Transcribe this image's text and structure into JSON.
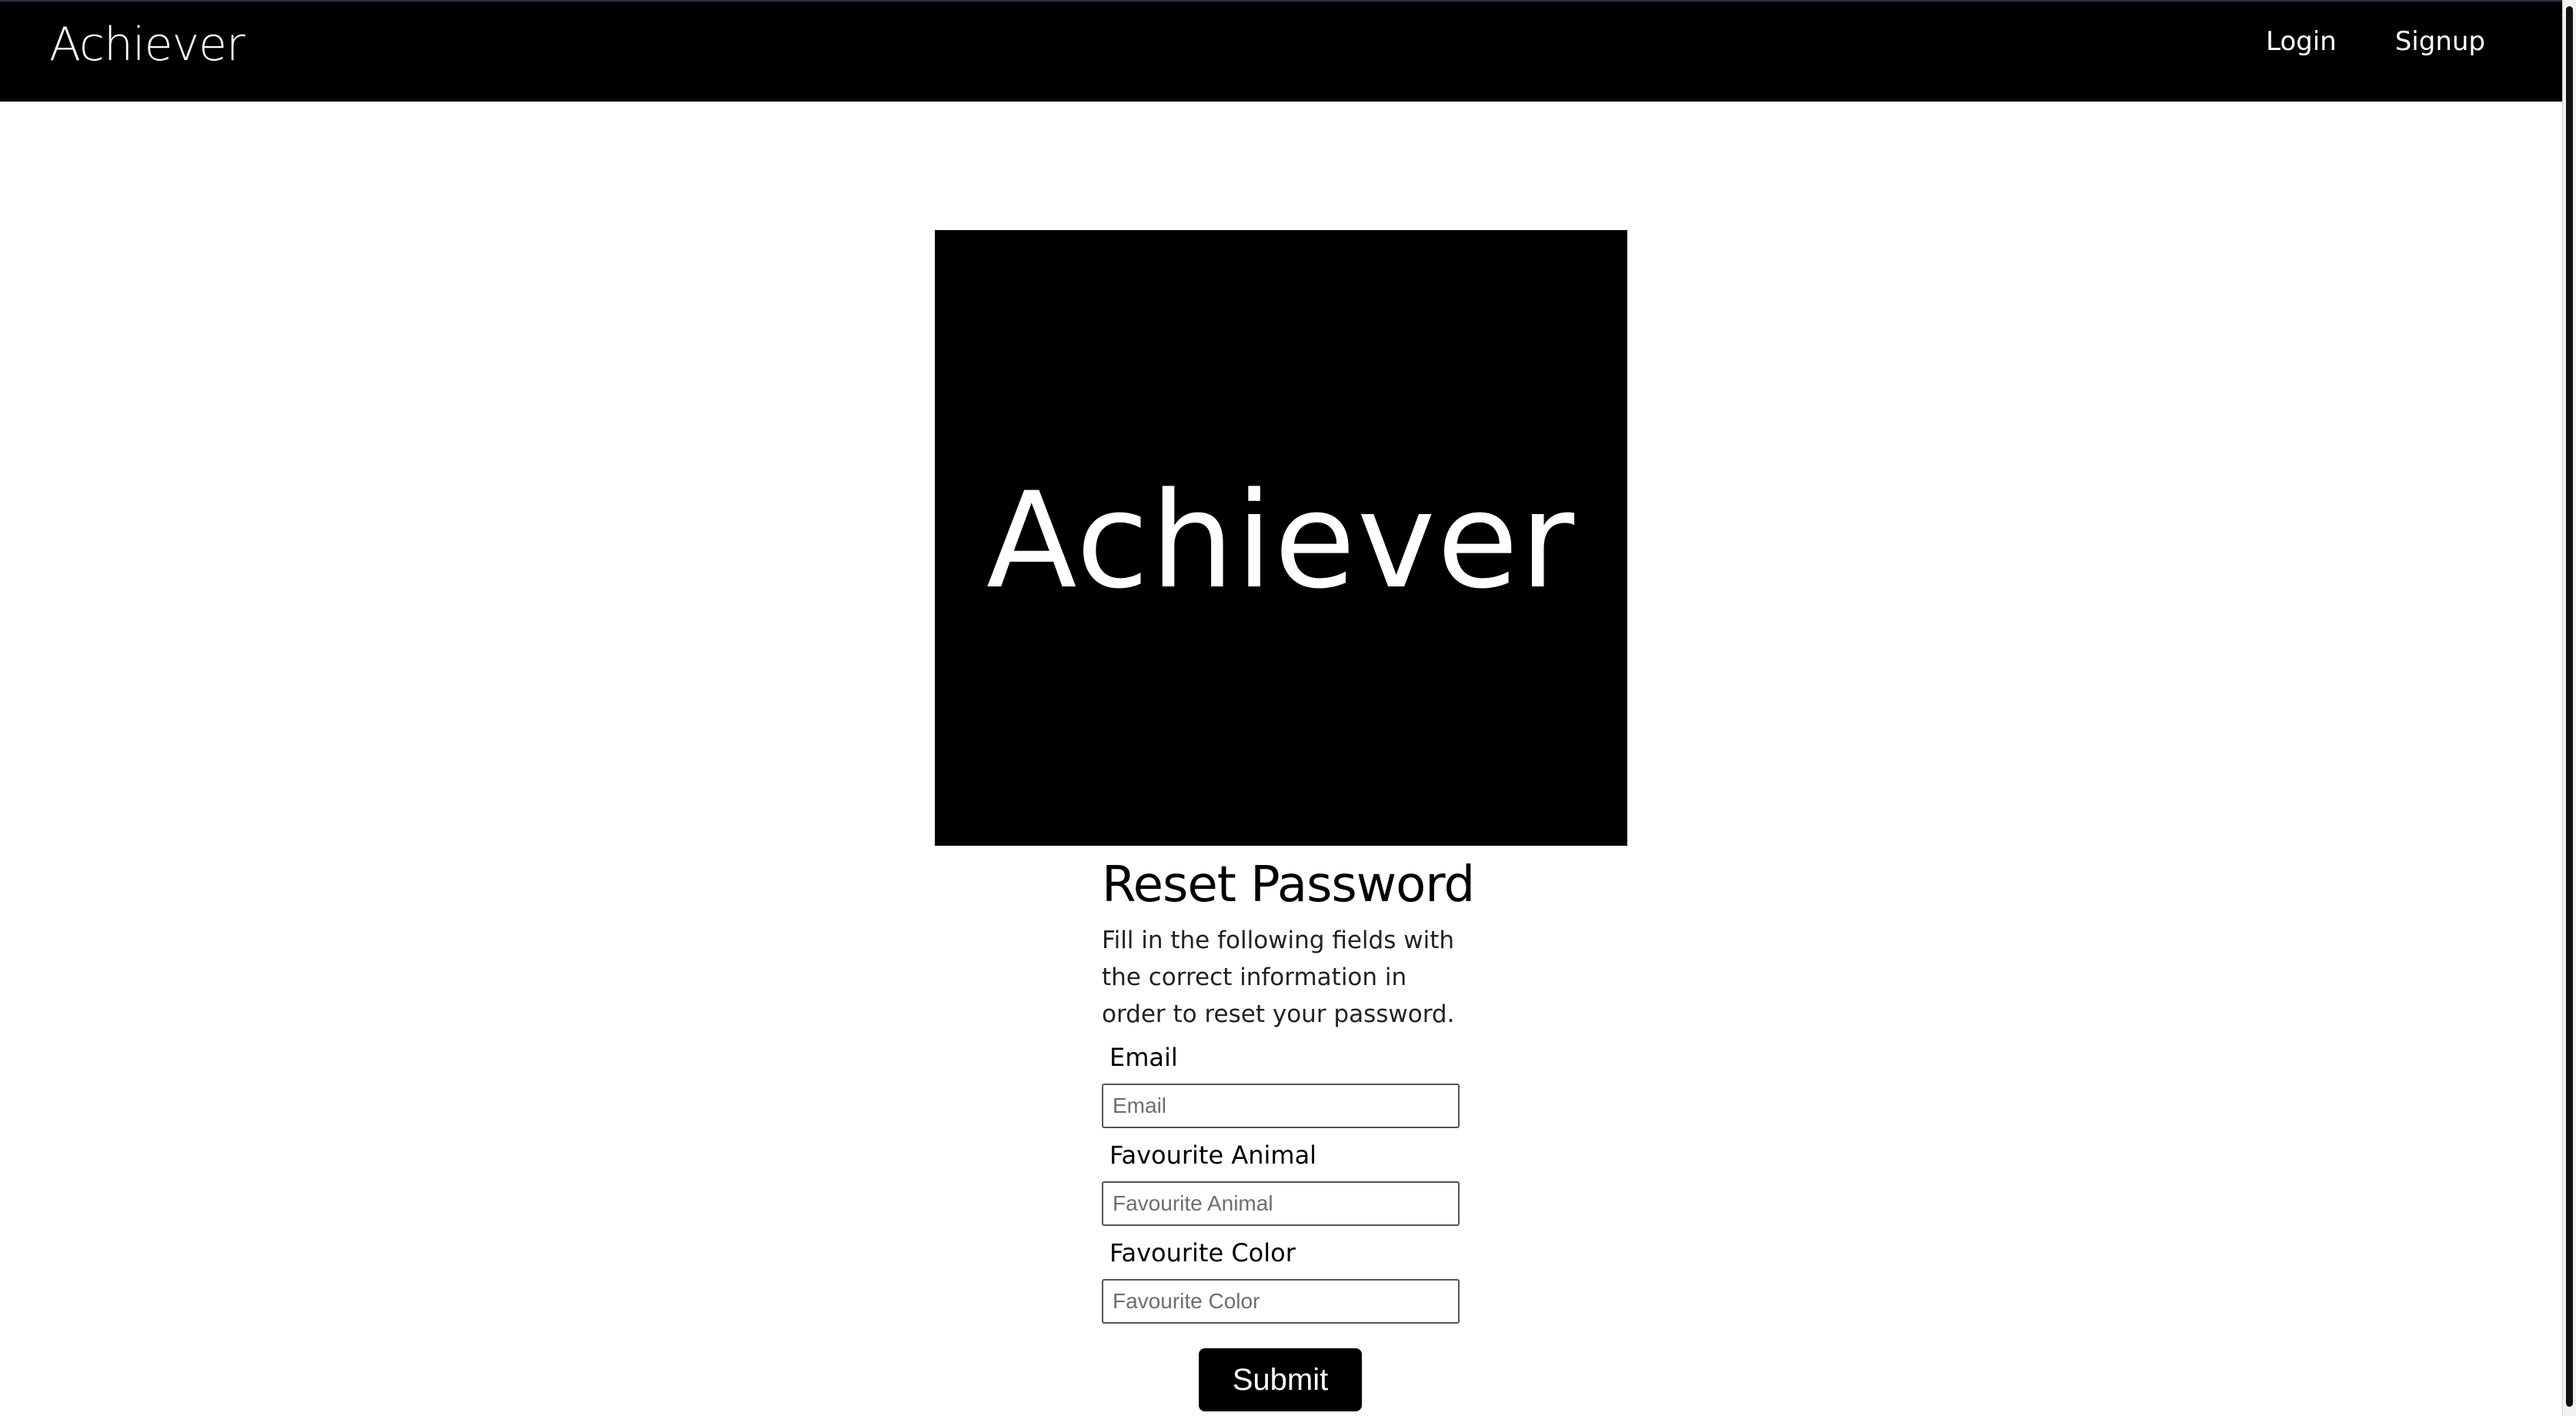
{
  "navbar": {
    "brand": "Achiever",
    "links": [
      {
        "label": "Login"
      },
      {
        "label": "Signup"
      }
    ]
  },
  "hero": {
    "title": "Achiever"
  },
  "form": {
    "title": "Reset Password",
    "description": "Fill in the following fields with the correct information in order to reset your password.",
    "fields": [
      {
        "label": "Email",
        "placeholder": "Email",
        "value": ""
      },
      {
        "label": "Favourite Animal",
        "placeholder": "Favourite Animal",
        "value": ""
      },
      {
        "label": "Favourite Color",
        "placeholder": "Favourite Color",
        "value": ""
      }
    ],
    "submit_label": "Submit"
  }
}
